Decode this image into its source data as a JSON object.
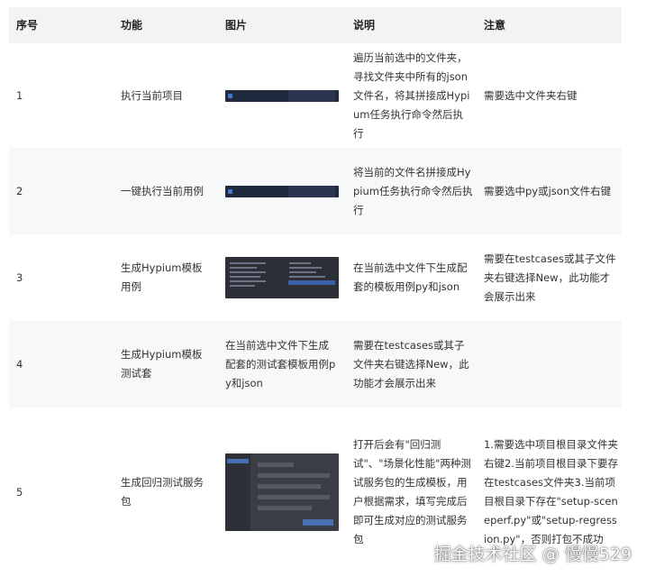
{
  "headers": [
    "序号",
    "功能",
    "图片",
    "说明",
    "注意"
  ],
  "rows": [
    {
      "no": "1",
      "feature": "执行当前项目",
      "image_text": "",
      "desc": "遍历当前选中的文件夹，寻找文件夹中所有的json文件名，将其拼接成Hypium任务执行命令然后执行",
      "note": "需要选中文件夹右键"
    },
    {
      "no": "2",
      "feature": "一键执行当前用例",
      "image_text": "",
      "desc": "将当前的文件名拼接成Hypium任务执行命令然后执行",
      "note": "需要选中py或json文件右键"
    },
    {
      "no": "3",
      "feature": "生成Hypium模板用例",
      "image_text": "",
      "desc": "在当前选中文件下生成配套的模板用例py和json",
      "note": "需要在testcases或其子文件夹右键选择New，此功能才会展示出来"
    },
    {
      "no": "4",
      "feature": "生成Hypium模板测试套",
      "image_text": "在当前选中文件下生成配套的测试套模板用例py和json",
      "desc": "需要在testcases或其子文件夹右键选择New，此功能才会展示出来",
      "note": ""
    },
    {
      "no": "5",
      "feature": "生成回归测试服务包",
      "image_text": "",
      "desc": "打开后会有\"回归测试\"、\"场景化性能\"两种测试服务包的生成模板，用户根据需求，填写完成后即可生成对应的测试服务包",
      "note": "1.需要选中项目根目录文件夹右键2.当前项目根目录下要存在testcases文件夹3.当前项目根目录下存在\"setup-sceneperf.py\"或\"setup-regression.py\"，否则打包不成功"
    }
  ],
  "watermark": "掘金技术社区 @ 慢慢529"
}
